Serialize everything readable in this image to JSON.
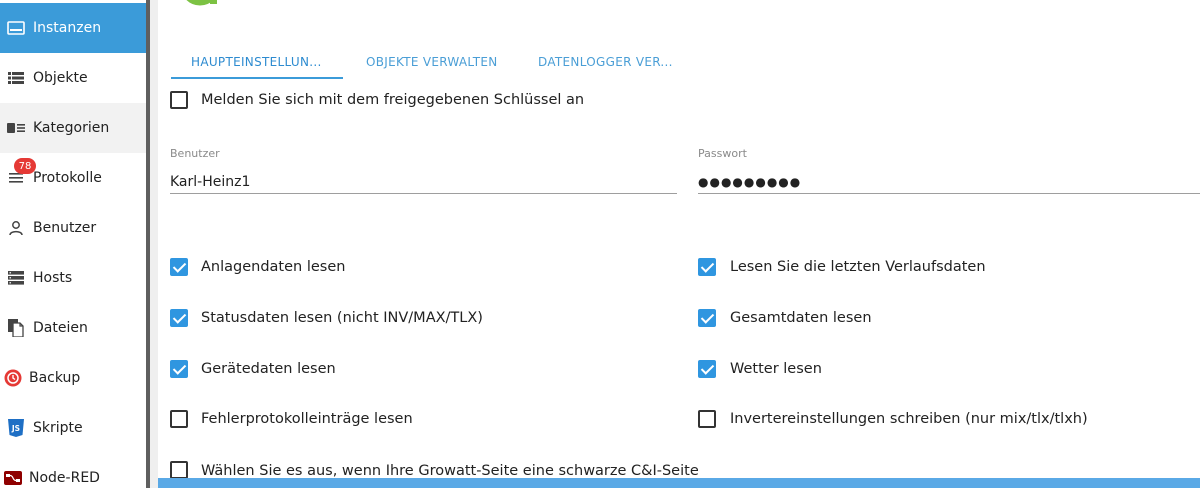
{
  "sidebar": {
    "items": [
      {
        "label": "Instanzen",
        "icon": "instances-icon"
      },
      {
        "label": "Objekte",
        "icon": "list-icon"
      },
      {
        "label": "Kategorien",
        "icon": "categories-icon"
      },
      {
        "label": "Protokolle",
        "icon": "log-icon",
        "badge": "78"
      },
      {
        "label": "Benutzer",
        "icon": "user-icon"
      },
      {
        "label": "Hosts",
        "icon": "hosts-icon"
      },
      {
        "label": "Dateien",
        "icon": "files-icon"
      },
      {
        "label": "Backup",
        "icon": "backup-icon"
      },
      {
        "label": "Skripte",
        "icon": "js-icon"
      },
      {
        "label": "Node-RED",
        "icon": "node-red-icon"
      }
    ],
    "active_color": "#3b9bd9"
  },
  "tabs": [
    {
      "label": "HAUPTEINSTELLUN...",
      "active": true
    },
    {
      "label": "OBJEKTE VERWALTEN",
      "active": false
    },
    {
      "label": "DATENLOGGER VER...",
      "active": false
    }
  ],
  "form": {
    "shared_key_label": "Melden Sie sich mit dem freigegebenen Schlüssel an",
    "user_label": "Benutzer",
    "user_value": "Karl-Heinz1",
    "password_label": "Passwort",
    "password_value": "●●●●●●●●●",
    "options": [
      {
        "label": "Anlagendaten lesen",
        "checked": true
      },
      {
        "label": "Lesen Sie die letzten Verlaufsdaten",
        "checked": true
      },
      {
        "label": "Statusdaten lesen (nicht INV/MAX/TLX)",
        "checked": true
      },
      {
        "label": "Gesamtdaten lesen",
        "checked": true
      },
      {
        "label": "Gerätedaten lesen",
        "checked": true
      },
      {
        "label": "Wetter lesen",
        "checked": true
      },
      {
        "label": "Fehlerprotokolleinträge lesen",
        "checked": false
      },
      {
        "label": "Invertereinstellungen schreiben (nur mix/tlx/tlxh)",
        "checked": false
      },
      {
        "label": "Wählen Sie es aus, wenn Ihre Growatt-Seite eine schwarze C&I-Seite",
        "checked": false
      }
    ]
  },
  "colors": {
    "checkbox_checked": "#2f96e0",
    "tab_text": "#2d8bd0",
    "logo_green": "#7cc243",
    "logo_blue": "#2f8fe0"
  }
}
